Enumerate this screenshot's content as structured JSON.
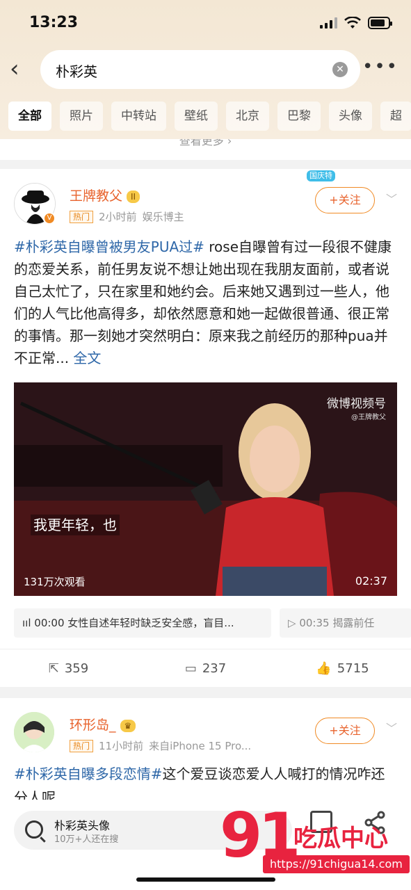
{
  "status": {
    "time": "13:23"
  },
  "search": {
    "query": "朴彩英"
  },
  "tabs": [
    "全部",
    "照片",
    "中转站",
    "壁纸",
    "北京",
    "巴黎",
    "头像",
    "超"
  ],
  "see_more": "查看更多 ›",
  "post1": {
    "user": "王牌教父",
    "level": "II",
    "hot": "热门",
    "time": "2小时前",
    "source": "娱乐博主",
    "follow": "+关注",
    "tag": "#朴彩英自曝曾被男友PUA过#",
    "text": " rose自曝曾有过一段很不健康的恋爱关系，前任男友说不想让她出现在我朋友面前，或者说自己太忙了，只在家里和她约会。后来她又遇到过一些人，他们的人气比他高得多，却依然愿意和她一起做很普通、很正常的事情。那一刻她才突然明白：原来我之前经历的那种pua并不正常...",
    "full": " 全文",
    "video": {
      "watermark": "微博视频号",
      "watermark_user": "@王牌教父",
      "subtitle": "我更年轻，也",
      "views": "131万次观看",
      "duration": "02:37"
    },
    "chapters": [
      {
        "time": "00:00",
        "text": "女性自述年轻时缺乏安全感，盲目..."
      },
      {
        "time": "00:35",
        "text": "揭露前任"
      }
    ],
    "actions": {
      "share": "359",
      "comment": "237",
      "like": "5715"
    }
  },
  "post2": {
    "user": "环形岛_",
    "hot": "热门",
    "time": "11小时前",
    "source": "来自iPhone 15 Pro...",
    "follow": "+关注",
    "tag": "#朴彩英自曝多段恋情#",
    "text": "这个爱豆谈恋爱人人喊打的情况咋还分人呢"
  },
  "bottom": {
    "title": "朴彩英头像",
    "sub": "10万+人还在搜"
  },
  "logo": {
    "number": "91",
    "name": "吃瓜中心",
    "url": "https://91chigua14.com"
  }
}
